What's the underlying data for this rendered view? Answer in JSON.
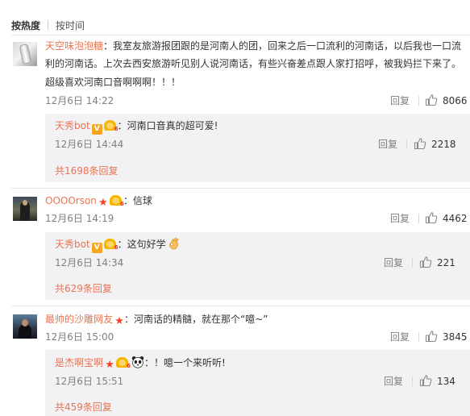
{
  "sort": {
    "hot": "按热度",
    "time": "按时间"
  },
  "comments": [
    {
      "user": "天空味泡泡糖",
      "text_line1": "：我室友旅游报团跟的是河南人的团，回来之后一口流利的河南话，以后我也一口流",
      "text_line2": "利的河南话。上次去西安旅游听见别人说河南话，有些兴奋差点跟人家打招呼，被我妈拦下来了。",
      "text_line3": "超级喜欢河南口音啊啊啊！！！",
      "time": "12月6日 14:22",
      "reply_label": "回复",
      "likes": "8066",
      "sub": {
        "user": "天秀bot",
        "badge": "V",
        "text": "：河南口音真的超可爱!",
        "time": "12月6日 14:44",
        "reply_label": "回复",
        "likes": "2218",
        "more": "共1698条回复"
      }
    },
    {
      "user": "OOOOrson",
      "text": "：信球",
      "time": "12月6日 14:19",
      "reply_label": "回复",
      "likes": "4462",
      "sub": {
        "user": "天秀bot",
        "badge": "V",
        "text": "：这句好学",
        "time": "12月6日 14:34",
        "reply_label": "回复",
        "likes": "221",
        "more": "共629条回复"
      }
    },
    {
      "user": "最帅的沙雕网友",
      "text": "：河南话的精髓，就在那个“噫~”",
      "time": "12月6日 15:00",
      "reply_label": "回复",
      "likes": "3845",
      "sub": {
        "user": "是杰啊宝啊",
        "text": "：！噫一个来听听!",
        "time": "12月6日 15:51",
        "reply_label": "回复",
        "likes": "134",
        "more": "共459条回复"
      }
    }
  ],
  "colors": {
    "username": "#eb7350",
    "meta": "#808080",
    "subbox": "#f2f2f5"
  }
}
